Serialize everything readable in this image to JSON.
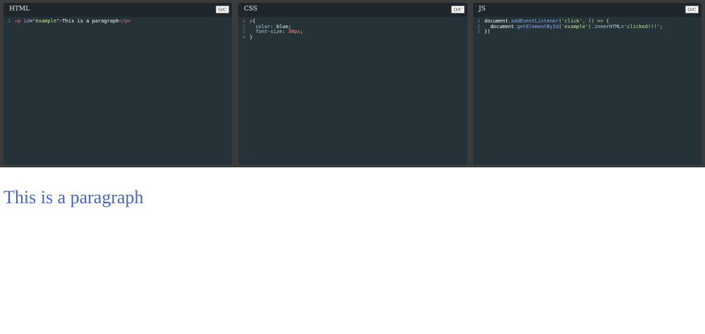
{
  "editors": {
    "toggle_label": "O/C",
    "html": {
      "title": "HTML",
      "line_numbers": [
        "1"
      ],
      "line1": {
        "open_tag": "<p",
        "attr": " id",
        "eq": "=",
        "value": "\"example\"",
        "close_bracket": ">",
        "text": "This is a paragraph",
        "end_tag": "</p>"
      }
    },
    "css": {
      "title": "CSS",
      "line_numbers": [
        "1",
        "2",
        "3",
        "4"
      ],
      "selector": "p",
      "open_brace": "{",
      "prop1": "color",
      "val1": "blue",
      "prop2": "font-size",
      "val2": "30px",
      "close_brace": "}"
    },
    "js": {
      "title": "JS",
      "line_numbers": [
        "1",
        "2",
        "3"
      ],
      "obj1": "document",
      "method1": ".addEventListener",
      "arg1": "('click', () => {",
      "obj2": "document",
      "method2": ".getElementById",
      "arg2": "('example')",
      "prop": ".innerHTML",
      "assign": "=",
      "str": "'clicked!!!'",
      "end2": ";",
      "close": "})"
    }
  },
  "output": {
    "paragraph": "This is a paragraph",
    "color": "#4466cc"
  }
}
